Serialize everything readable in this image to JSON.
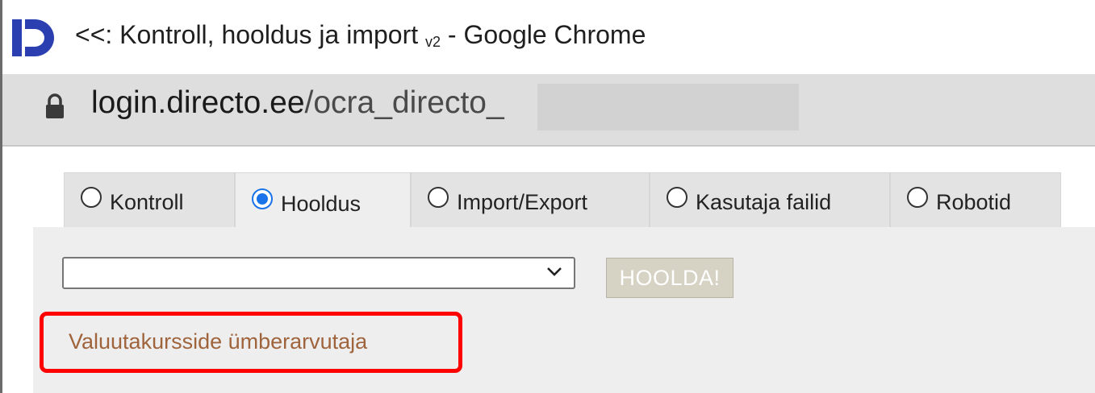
{
  "window": {
    "title_prefix": "<<: Kontroll, hooldus ja import",
    "title_version": "v2",
    "title_suffix": " - Google Chrome"
  },
  "address_bar": {
    "host": "login.directo.ee",
    "path": "/ocra_directo_"
  },
  "tabs": [
    {
      "label": "Kontroll",
      "selected": false
    },
    {
      "label": "Hooldus",
      "selected": true
    },
    {
      "label": "Import/Export",
      "selected": false
    },
    {
      "label": "Kasutaja failid",
      "selected": false
    },
    {
      "label": "Robotid",
      "selected": false
    }
  ],
  "maintenance": {
    "select_value": "",
    "button_label": "HOOLDA!",
    "tool_label": "Valuutakursside ümberarvutaja"
  },
  "colors": {
    "accent_blue": "#1a73e8",
    "logo_blue": "#2b3fb0",
    "highlight_red": "#ff0000",
    "tool_label_brown": "#a0643c"
  }
}
